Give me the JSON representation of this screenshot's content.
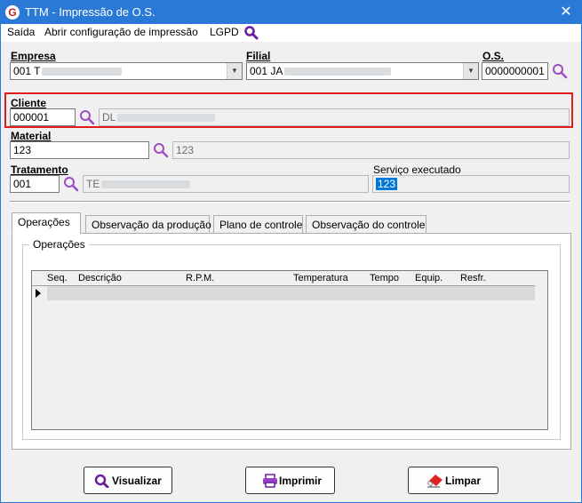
{
  "window": {
    "title": "TTM - Impressão de O.S.",
    "app_icon_glyph": "G",
    "close_glyph": "✕"
  },
  "menu": {
    "items": [
      "Saída",
      "Abrir configuração de impressão",
      "LGPD"
    ]
  },
  "empresa": {
    "label": "Empresa",
    "value": "001 T"
  },
  "filial": {
    "label": "Filial",
    "value": "001 JA"
  },
  "os": {
    "label": "O.S.",
    "value": "0000000001"
  },
  "cliente": {
    "label": "Cliente",
    "code": "000001",
    "name": "DL"
  },
  "material": {
    "label": "Material",
    "code": "123",
    "description": "123"
  },
  "tratamento": {
    "label": "Tratamento",
    "code": "001",
    "description": "TE"
  },
  "servico": {
    "label": "Serviço executado",
    "value": "123"
  },
  "tabs": [
    "Operações",
    "Observação da produção",
    "Plano de controle",
    "Observação do controle"
  ],
  "operacoes": {
    "group_title": "Operações",
    "columns": [
      "Seq.",
      "Descrição",
      "R.P.M.",
      "Temperatura",
      "Tempo",
      "Equip.",
      "Resfr."
    ]
  },
  "buttons": {
    "visualizar": "Visualizar",
    "imprimir": "Imprimir",
    "limpar": "Limpar"
  },
  "colors": {
    "titlebar": "#2b79d6",
    "highlight": "#e31b1b",
    "search_icon": "#a04bc4",
    "selection": "#0078d7"
  }
}
